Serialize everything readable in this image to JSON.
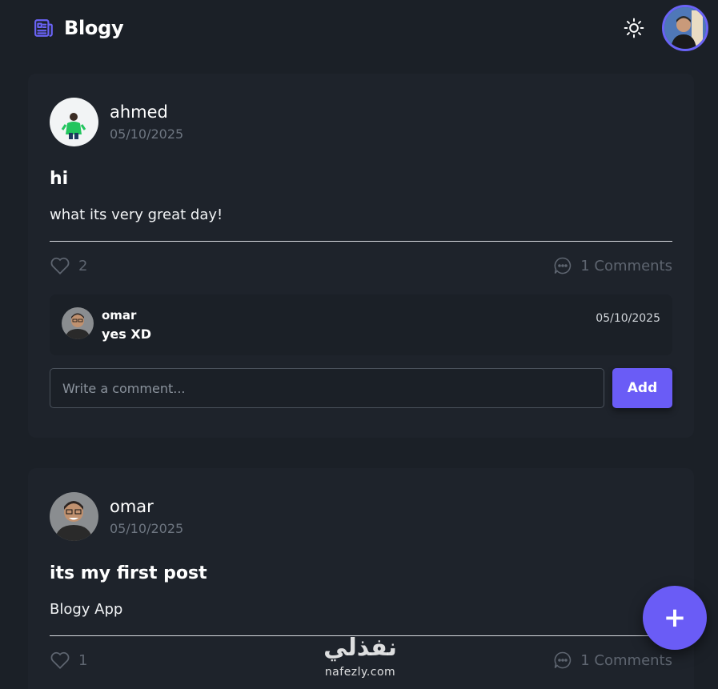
{
  "header": {
    "brand_title": "Blogy",
    "brand_icon": "newspaper-icon",
    "theme_icon": "sun-icon"
  },
  "colors": {
    "accent": "#6a5cf6",
    "background": "#1b2027",
    "card": "#1e232b",
    "muted": "#6e7681"
  },
  "posts": [
    {
      "author": "ahmed",
      "date": "05/10/2025",
      "title": "hi",
      "body": "what its very great day!",
      "likes": "2",
      "comments_label": "1 Comments",
      "comments": [
        {
          "author": "omar",
          "text": "yes XD",
          "date": "05/10/2025"
        }
      ],
      "comment_placeholder": "Write a comment...",
      "add_label": "Add"
    },
    {
      "author": "omar",
      "date": "05/10/2025",
      "title": "its my first post",
      "body": "Blogy App",
      "likes": "1",
      "comments_label": "1 Comments"
    }
  ],
  "fab": {
    "label": "+"
  },
  "watermark": {
    "arabic": "نفذلي",
    "url": "nafezly.com"
  }
}
